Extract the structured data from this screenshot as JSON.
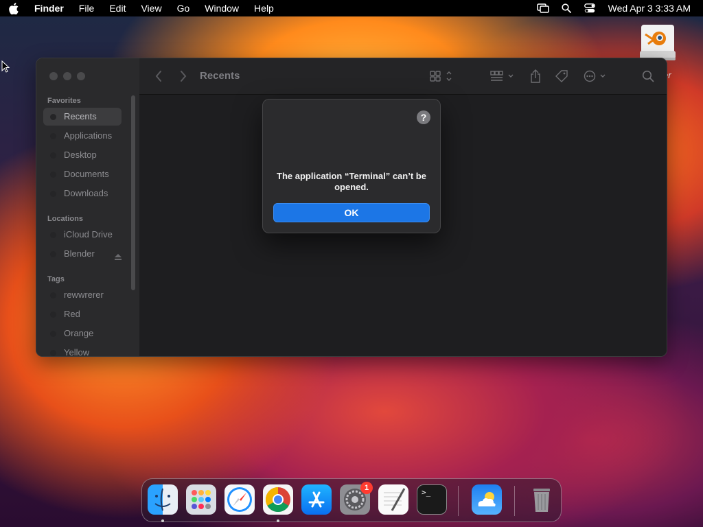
{
  "menubar": {
    "app_name": "Finder",
    "items": [
      "File",
      "Edit",
      "View",
      "Go",
      "Window",
      "Help"
    ],
    "clock": "Wed Apr 3  3:33 AM"
  },
  "desktop": {
    "partial_label": "er"
  },
  "finder": {
    "title": "Recents",
    "sidebar": {
      "favorites_header": "Favorites",
      "favorites": [
        "Recents",
        "Applications",
        "Desktop",
        "Documents",
        "Downloads"
      ],
      "locations_header": "Locations",
      "locations": [
        "iCloud Drive",
        "Blender"
      ],
      "tags_header": "Tags",
      "tags": [
        "rewwrerer",
        "Red",
        "Orange",
        "Yellow"
      ]
    }
  },
  "alert": {
    "help_glyph": "?",
    "message": "The application “Terminal” can’t be opened.",
    "ok_label": "OK"
  },
  "dock": {
    "apps": [
      "finder-icon",
      "launchpad-icon",
      "safari-icon",
      "chrome-icon",
      "app-store-icon",
      "system-settings-icon",
      "textedit-icon",
      "terminal-icon",
      "weather-icon",
      "trash-icon"
    ],
    "settings_badge": "1",
    "terminal_glyph": ">_"
  },
  "colors": {
    "accent": "#1c76e6",
    "badge": "#ff3b30"
  }
}
